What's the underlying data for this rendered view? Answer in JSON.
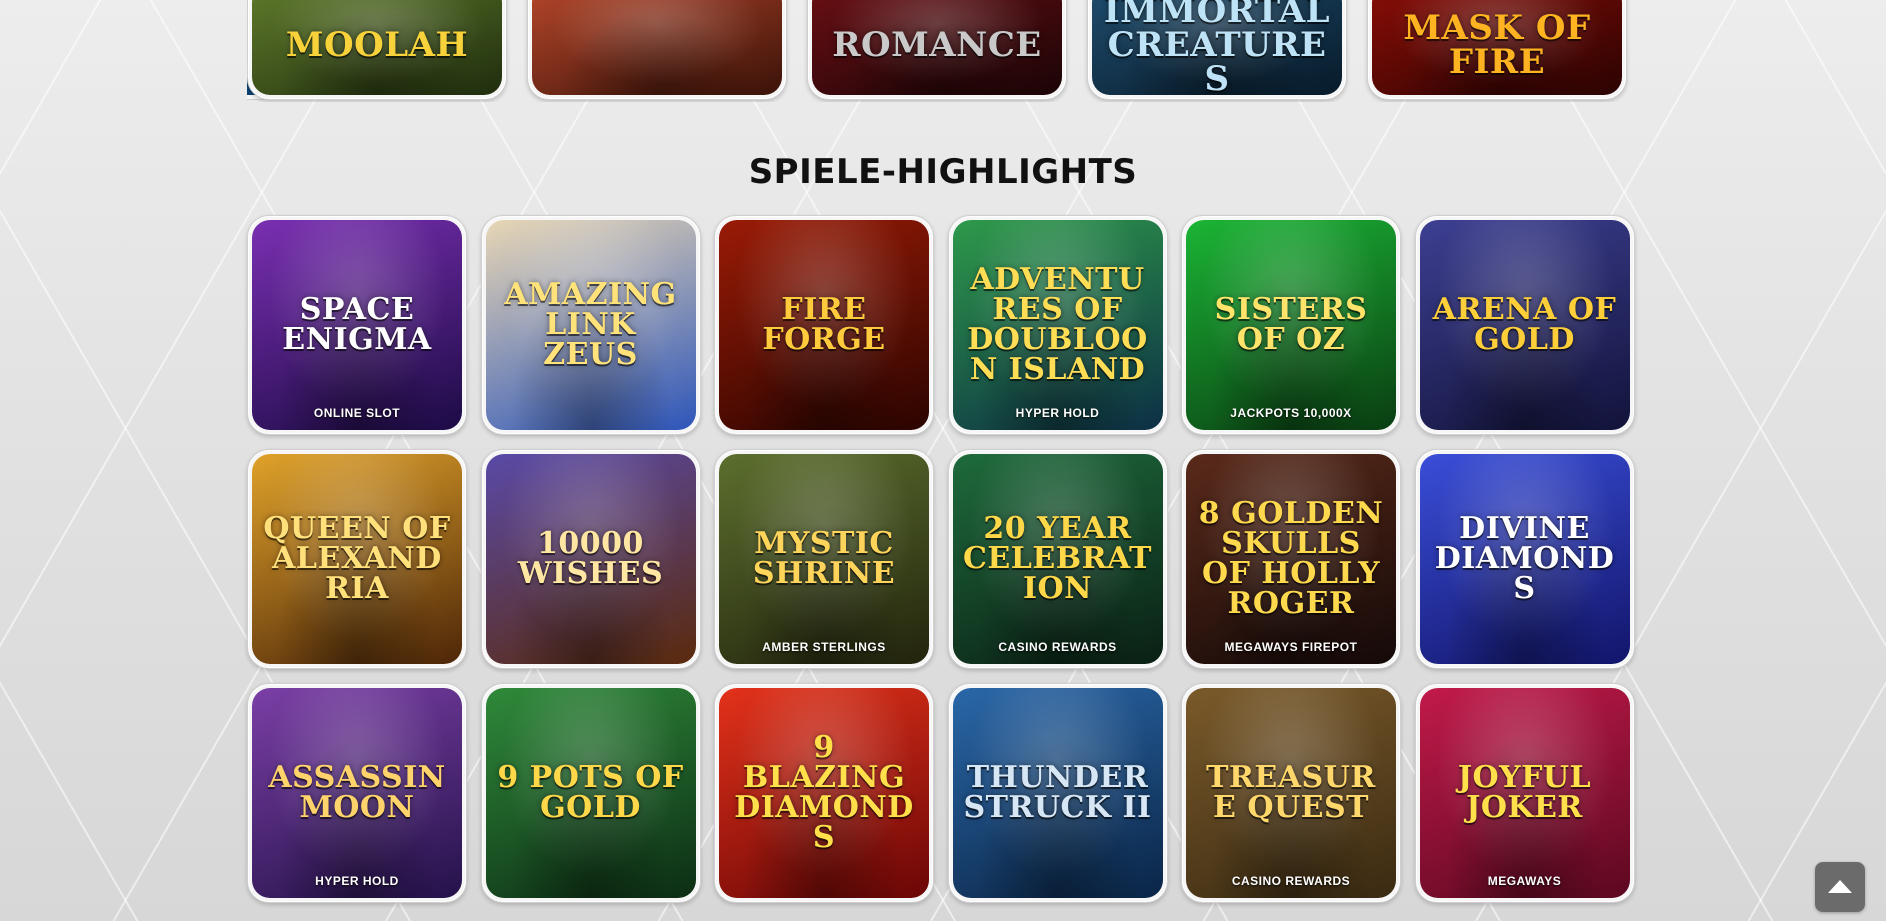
{
  "section": {
    "title": "SPIELE-HIGHLIGHTS"
  },
  "top_row": [
    {
      "title": "MOOLAH",
      "bg": [
        "#5f7a2a",
        "#1f2d0e"
      ],
      "fg": "#f7d23a"
    },
    {
      "title": "",
      "bg": [
        "#b5462a",
        "#3a1208"
      ],
      "fg": "#f3c644"
    },
    {
      "title": "ROMANCE",
      "bg": [
        "#6a0f14",
        "#1a0406"
      ],
      "fg": "#c9c9c9"
    },
    {
      "title": "IMMORTAL CREATURES",
      "bg": [
        "#1f4d6e",
        "#071a29"
      ],
      "fg": "#bfe3f6"
    },
    {
      "title": "MASK OF FIRE",
      "bg": [
        "#8a0d06",
        "#2a0302"
      ],
      "fg": "#ffb321"
    }
  ],
  "games": [
    {
      "title": "SPACE ENIGMA",
      "subtitle": "ONLINE SLOT",
      "bg": [
        "#7a2fb2",
        "#1c0b45"
      ],
      "fg": "#ffffff"
    },
    {
      "title": "AMAZING LINK ZEUS",
      "subtitle": "",
      "bg": [
        "#e8d7b5",
        "#2d55b9"
      ],
      "fg": "#ffe37a"
    },
    {
      "title": "FIRE FORGE",
      "subtitle": "",
      "bg": [
        "#9a1b06",
        "#2b0400"
      ],
      "fg": "#ffcb3c"
    },
    {
      "title": "ADVENTURES OF DOUBLOON ISLAND",
      "subtitle": "HYPER HOLD",
      "bg": [
        "#2e9a4a",
        "#0c2f45"
      ],
      "fg": "#ffdd55"
    },
    {
      "title": "SISTERS OF OZ",
      "subtitle": "JACKPOTS 10,000X",
      "bg": [
        "#1bb535",
        "#0a3d12"
      ],
      "fg": "#ffe36a"
    },
    {
      "title": "ARENA OF GOLD",
      "subtitle": "",
      "bg": [
        "#3d3f92",
        "#12133a"
      ],
      "fg": "#ffcf3a"
    },
    {
      "title": "QUEEN OF ALEXANDRIA",
      "subtitle": "",
      "bg": [
        "#e0a22a",
        "#4d2608"
      ],
      "fg": "#ffe07a"
    },
    {
      "title": "10000 WISHES",
      "subtitle": "",
      "bg": [
        "#5a4aa8",
        "#5a2a0c"
      ],
      "fg": "#ffe7a3"
    },
    {
      "title": "MYSTIC SHRINE",
      "subtitle": "AMBER STERLINGS",
      "bg": [
        "#5c6f2e",
        "#22240d"
      ],
      "fg": "#ffd45a"
    },
    {
      "title": "20 YEAR CELEBRATION",
      "subtitle": "CASINO REWARDS",
      "bg": [
        "#1e6b3c",
        "#0a1f14"
      ],
      "fg": "#ffd84a"
    },
    {
      "title": "8 GOLDEN SKULLS OF HOLLY ROGER",
      "subtitle": "MEGAWAYS FIREPOT",
      "bg": [
        "#5a2a1a",
        "#140908"
      ],
      "fg": "#ffd94d"
    },
    {
      "title": "DIVINE DIAMONDS",
      "subtitle": "",
      "bg": [
        "#3a4ed8",
        "#12156a"
      ],
      "fg": "#ffffff"
    },
    {
      "title": "ASSASSIN MOON",
      "subtitle": "HYPER HOLD",
      "bg": [
        "#7b3fa6",
        "#24124a"
      ],
      "fg": "#ffd36b"
    },
    {
      "title": "9 POTS OF GOLD",
      "subtitle": "",
      "bg": [
        "#2f8a3a",
        "#0c2d14"
      ],
      "fg": "#ffd84a"
    },
    {
      "title": "9 BLAZING DIAMONDS",
      "subtitle": "",
      "bg": [
        "#e3321a",
        "#6a0606"
      ],
      "fg": "#ffe04a"
    },
    {
      "title": "THUNDER STRUCK II",
      "subtitle": "",
      "bg": [
        "#2a67a8",
        "#0a2546"
      ],
      "fg": "#d6e6f4"
    },
    {
      "title": "TREASURE QUEST",
      "subtitle": "CASINO REWARDS",
      "bg": [
        "#7a5a2a",
        "#3a2a12"
      ],
      "fg": "#ffd76a"
    },
    {
      "title": "JOYFUL JOKER",
      "subtitle": "MEGAWAYS",
      "bg": [
        "#c21a4a",
        "#5c0820"
      ],
      "fg": "#ffe04a"
    }
  ],
  "controls": {
    "scroll_top_icon": "chevron-up-icon"
  }
}
